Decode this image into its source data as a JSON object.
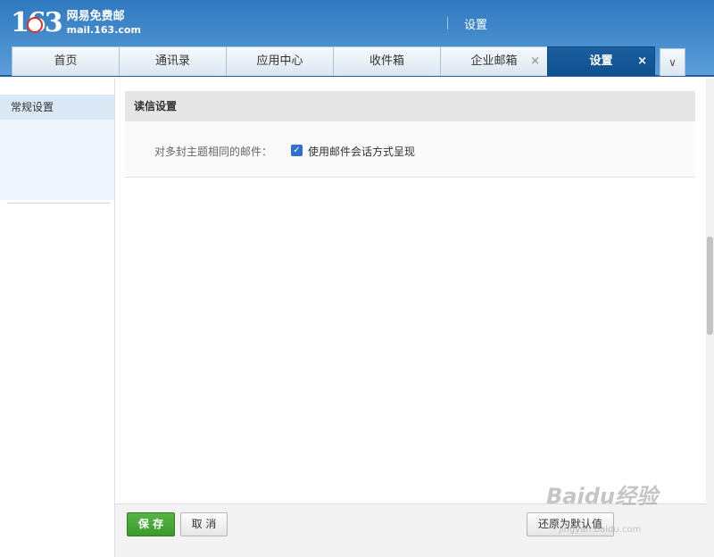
{
  "header": {
    "logo_number": "163",
    "logo_name": "网易免费邮",
    "logo_domain": "mail.163.com",
    "title": "设置"
  },
  "tabs": [
    {
      "label": "首页",
      "active": false,
      "closable": false
    },
    {
      "label": "通讯录",
      "active": false,
      "closable": false
    },
    {
      "label": "应用中心",
      "active": false,
      "closable": false
    },
    {
      "label": "收件箱",
      "active": false,
      "closable": false
    },
    {
      "label": "企业邮箱",
      "active": false,
      "closable": true
    },
    {
      "label": "设置",
      "active": true,
      "closable": true
    }
  ],
  "close_glyph": "×",
  "more_glyph": "∨",
  "sidebar": {
    "items": [
      {
        "label": "常规设置",
        "selected": true
      }
    ]
  },
  "section": {
    "title": "读信设置",
    "row_label": "对多封主题相同的邮件：",
    "checkbox_label": "使用邮件会话方式呈现",
    "checkbox_checked": true,
    "check_glyph": "✓"
  },
  "footer": {
    "save_label": "保 存",
    "cancel_label": "取 消",
    "reset_label": "还原为默认值"
  },
  "watermark": {
    "text": "Baidu经验",
    "url": "jingyan.baidu.com"
  },
  "colors": {
    "header": "#2f79c0",
    "active_tab": "#1b5f9f",
    "save_button": "#4caa3a",
    "checkbox": "#2f6fd0"
  }
}
